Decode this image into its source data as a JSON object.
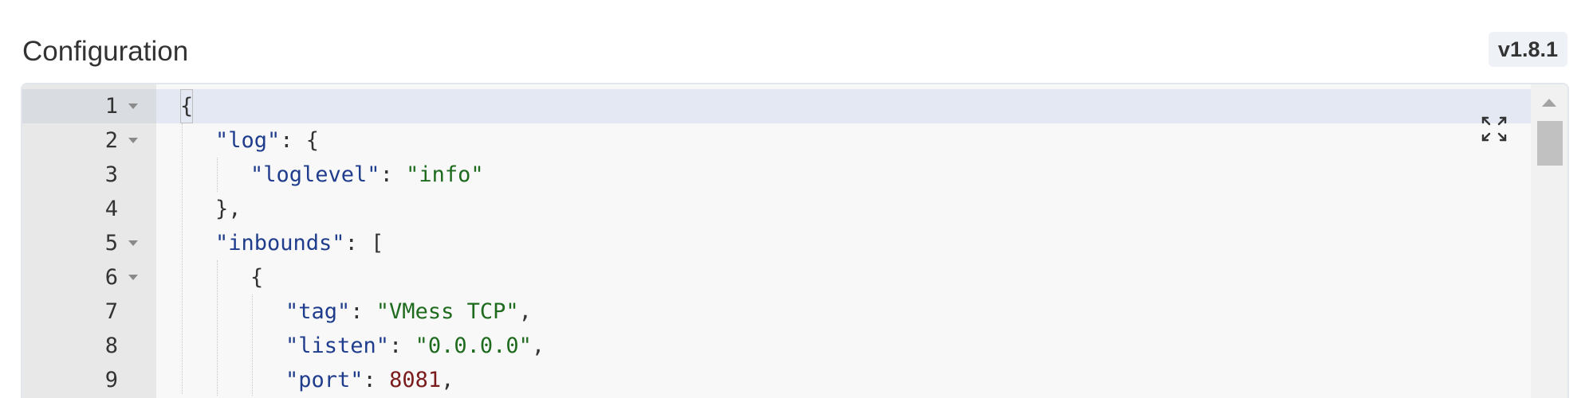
{
  "header": {
    "title": "Configuration",
    "version": "v1.8.1"
  },
  "editor": {
    "lines": [
      {
        "num": "1",
        "fold": true
      },
      {
        "num": "2",
        "fold": true
      },
      {
        "num": "3",
        "fold": false
      },
      {
        "num": "4",
        "fold": false
      },
      {
        "num": "5",
        "fold": true
      },
      {
        "num": "6",
        "fold": true
      },
      {
        "num": "7",
        "fold": false
      },
      {
        "num": "8",
        "fold": false
      },
      {
        "num": "9",
        "fold": false
      }
    ],
    "tokens": {
      "l1_open": "{",
      "l2_key": "\"log\"",
      "l2_rest": ": {",
      "l3_key": "\"loglevel\"",
      "l3_colon": ": ",
      "l3_val": "\"info\"",
      "l4": "},",
      "l5_key": "\"inbounds\"",
      "l5_rest": ": [",
      "l6": "{",
      "l7_key": "\"tag\"",
      "l7_colon": ": ",
      "l7_val": "\"VMess TCP\"",
      "l7_comma": ",",
      "l8_key": "\"listen\"",
      "l8_colon": ": ",
      "l8_val": "\"0.0.0.0\"",
      "l8_comma": ",",
      "l9_key": "\"port\"",
      "l9_colon": ": ",
      "l9_val": "8081",
      "l9_comma": ","
    }
  },
  "colors": {
    "key": "#1f3d8c",
    "string": "#1e6b1e",
    "number": "#7a1c1c",
    "gutter": "#e8e8e8",
    "active_line": "#e3e8f2"
  },
  "icons": {
    "expand": "expand-icon",
    "fold": "fold-arrow-icon",
    "scroll_up": "scroll-up-icon"
  }
}
